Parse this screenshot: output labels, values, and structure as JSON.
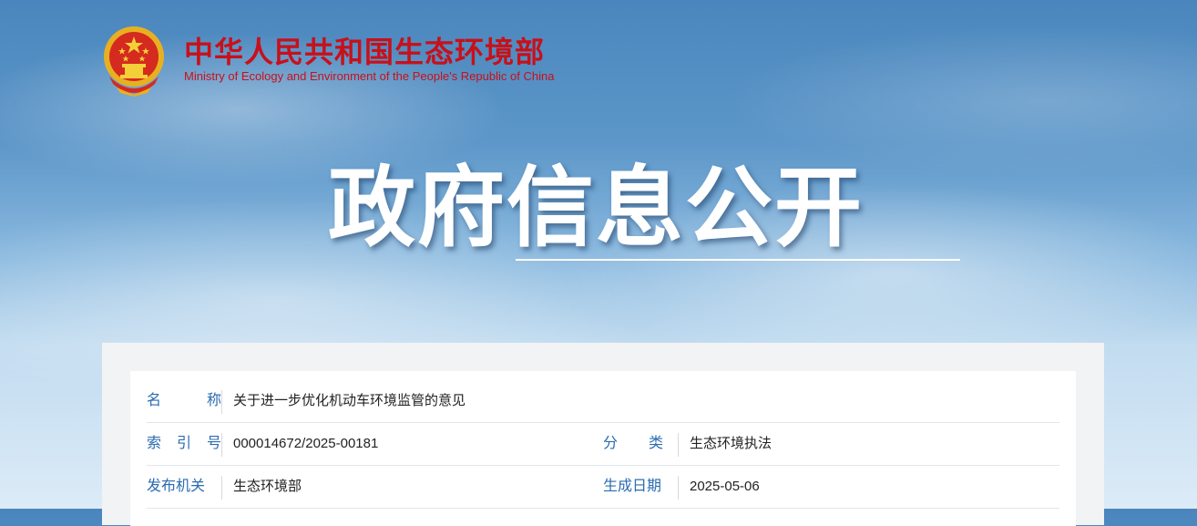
{
  "header": {
    "site_title_cn": "中华人民共和国生态环境部",
    "site_title_en": "Ministry of Ecology and Environment of the People's Republic of China"
  },
  "banner": {
    "title": "政府信息公开"
  },
  "colors": {
    "brand_red": "#c8101a",
    "label_blue": "#2b6cb0"
  },
  "info_table": {
    "rows": [
      {
        "label": "名称",
        "value": "关于进一步优化机动车环境监管的意见"
      },
      {
        "label": "索引号",
        "value": "000014672/2025-00181",
        "label2": "分类",
        "value2": "生态环境执法"
      },
      {
        "label": "发布机关",
        "value": "生态环境部",
        "label2": "生成日期",
        "value2": "2025-05-06"
      }
    ]
  }
}
